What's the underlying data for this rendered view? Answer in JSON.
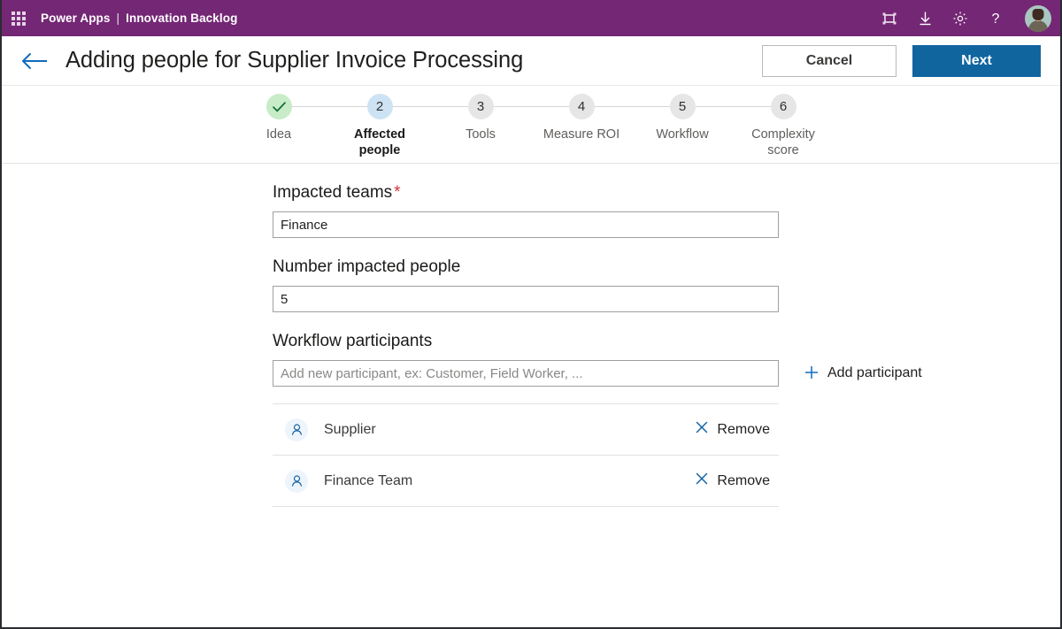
{
  "topbar": {
    "waffle_icon": "app-launcher-icon",
    "brand": "Power Apps",
    "separator": "|",
    "app_name": "Innovation Backlog",
    "icons": [
      {
        "name": "fit-to-screen-icon",
        "glyph": "frame"
      },
      {
        "name": "download-icon",
        "glyph": "download"
      },
      {
        "name": "settings-gear-icon",
        "glyph": "gear"
      },
      {
        "name": "help-icon",
        "glyph": "?"
      }
    ],
    "avatar_alt": "user-avatar"
  },
  "command_bar": {
    "back_icon": "back-arrow-icon",
    "title": "Adding people for Supplier Invoice Processing",
    "cancel_label": "Cancel",
    "next_label": "Next"
  },
  "stepper": {
    "steps": [
      {
        "number": "1",
        "label": "Idea",
        "state": "done"
      },
      {
        "number": "2",
        "label": "Affected people",
        "state": "active"
      },
      {
        "number": "3",
        "label": "Tools",
        "state": "todo"
      },
      {
        "number": "4",
        "label": "Measure ROI",
        "state": "todo"
      },
      {
        "number": "5",
        "label": "Workflow",
        "state": "todo"
      },
      {
        "number": "6",
        "label": "Complexity score",
        "state": "todo"
      }
    ]
  },
  "form": {
    "impacted_teams": {
      "label": "Impacted teams",
      "required_marker": "*",
      "value": "Finance",
      "placeholder": ""
    },
    "number_impacted_people": {
      "label": "Number impacted people",
      "value": "5",
      "placeholder": ""
    },
    "workflow_participants": {
      "label": "Workflow participants",
      "value": "",
      "placeholder": "Add new participant, ex: Customer, Field Worker, ...",
      "add_label": "Add participant",
      "add_icon": "plus-icon",
      "remove_label": "Remove",
      "remove_icon": "close-x-icon",
      "items": [
        {
          "name": "Supplier"
        },
        {
          "name": "Finance Team"
        }
      ]
    }
  },
  "colors": {
    "brand_purple": "#742774",
    "primary_blue": "#11659f",
    "link_blue": "#0f6cbd",
    "required_red": "#d13438",
    "step_done_green": "#c8ebc8",
    "step_active_blue": "#cde3f4",
    "step_todo_grey": "#e6e6e6"
  }
}
